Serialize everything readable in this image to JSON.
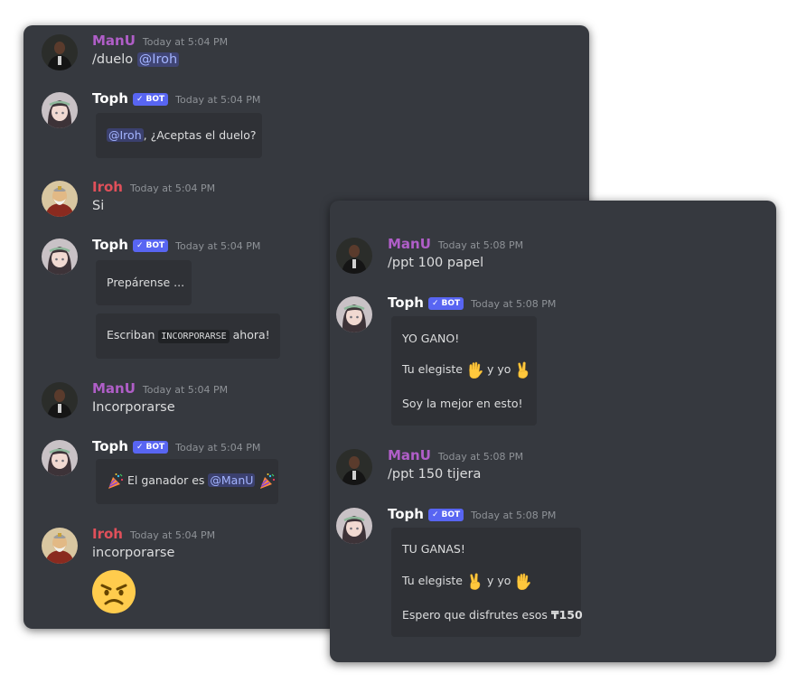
{
  "left": {
    "messages": [
      {
        "author": "ManU",
        "time": "Today at 5:04 PM",
        "command": "/duelo",
        "mention": "@Iroh"
      },
      {
        "author": "Toph",
        "bot": "BOT",
        "time": "Today at 5:04 PM",
        "mention": "@Iroh",
        "text": ", ¿Aceptas el duelo?"
      },
      {
        "author": "Iroh",
        "time": "Today at 5:04 PM",
        "text": "Si"
      },
      {
        "author": "Toph",
        "bot": "BOT",
        "time": "Today at 5:04 PM",
        "embed1": "Prepárense ...",
        "embed2_pre": "Escriban",
        "embed2_code": "INCORPORARSE",
        "embed2_post": "ahora!"
      },
      {
        "author": "ManU",
        "time": "Today at 5:04 PM",
        "text": "Incorporarse"
      },
      {
        "author": "Toph",
        "bot": "BOT",
        "time": "Today at 5:04 PM",
        "pre": "El ganador es",
        "mention": "@ManU"
      },
      {
        "author": "Iroh",
        "time": "Today at 5:04 PM",
        "text": "incorporarse",
        "reaction": "angry-face"
      }
    ]
  },
  "right": {
    "messages": [
      {
        "author": "ManU",
        "time": "Today at 5:08 PM",
        "text": "/ppt 100 papel"
      },
      {
        "author": "Toph",
        "bot": "BOT",
        "time": "Today at 5:08 PM",
        "line1": "YO GANO!",
        "line2_pre": "Tu elegiste",
        "line2_mid": "y yo",
        "line3": "Soy la mejor en esto!"
      },
      {
        "author": "ManU",
        "time": "Today at 5:08 PM",
        "text": "/ppt 150 tijera"
      },
      {
        "author": "Toph",
        "bot": "BOT",
        "time": "Today at 5:08 PM",
        "line1": "TU GANAS!",
        "line2_pre": "Tu elegiste",
        "line2_mid": "y yo",
        "line3_pre": "Espero que disfrutes esos",
        "line3_amount": "₸150"
      }
    ]
  },
  "colors": {
    "background": "#36393f",
    "embed": "#2f3136",
    "manu": "#b05ec8",
    "iroh": "#e0505a",
    "bot_badge": "#5865f2",
    "mention": "#a3b4ff"
  }
}
